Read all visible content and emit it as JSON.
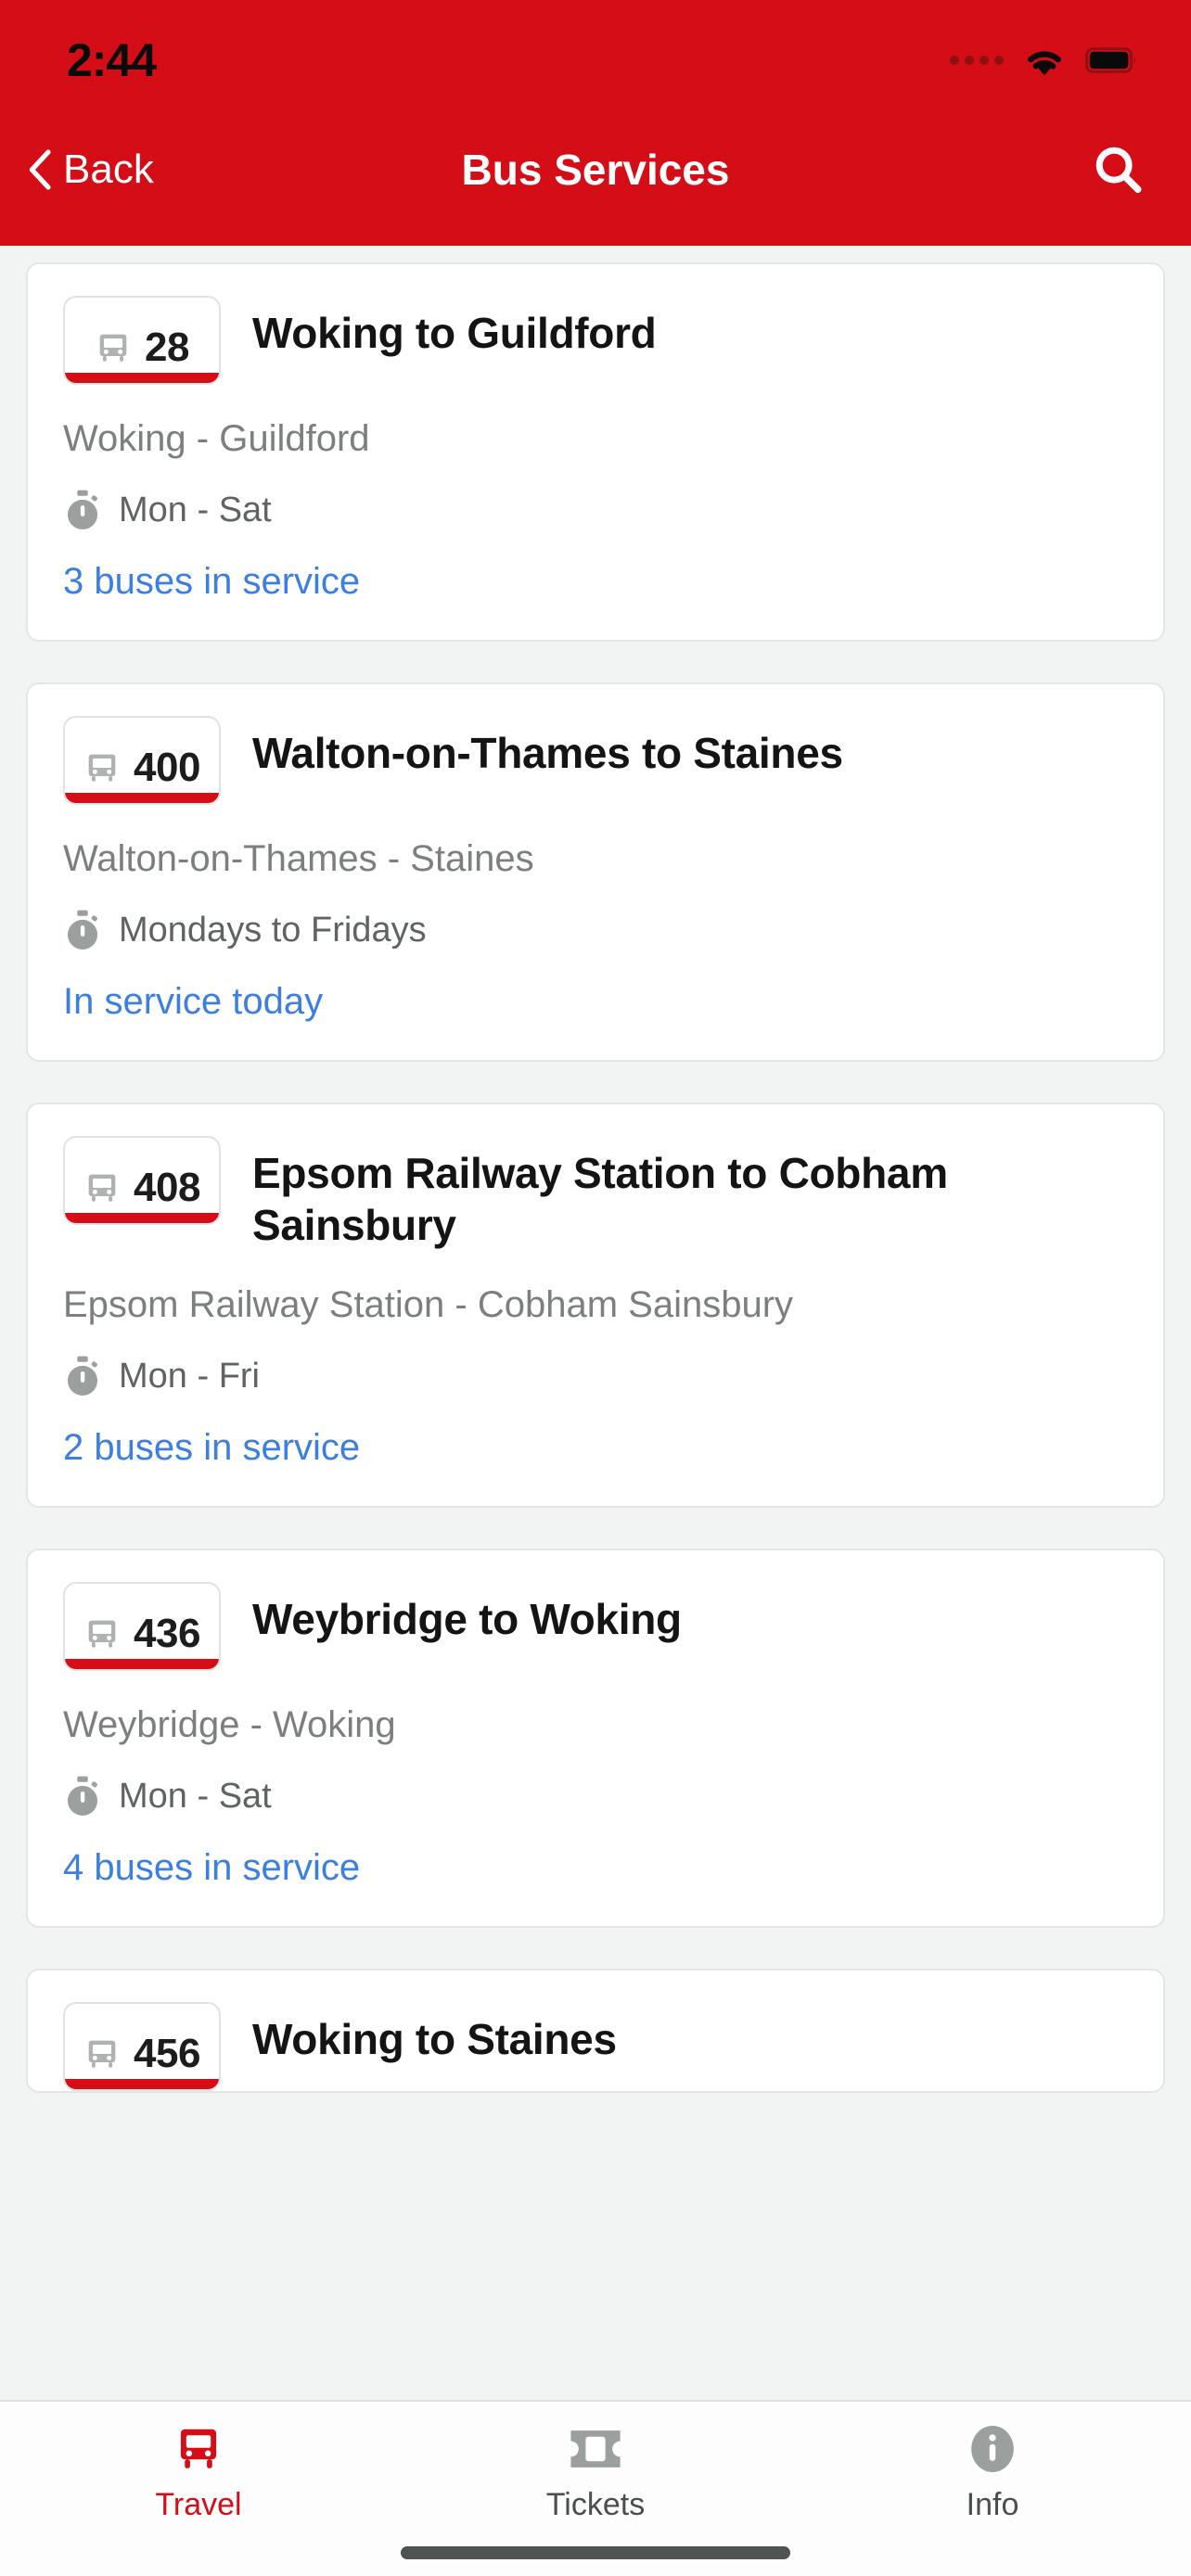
{
  "status_bar": {
    "time": "2:44",
    "signal_icon": "signal-dots-icon",
    "wifi_icon": "wifi-icon",
    "battery_icon": "battery-full-icon"
  },
  "nav": {
    "back_label": "Back",
    "back_icon": "chevron-left-icon",
    "title": "Bus Services",
    "search_icon": "search-icon"
  },
  "colors": {
    "brand_red": "#d40d17",
    "link_blue": "#3d7fe0",
    "page_bg": "#f1f4f3",
    "card_bg": "#ffffff",
    "muted_text": "#7b7f7e"
  },
  "services": [
    {
      "number": "28",
      "bus_icon": "bus-icon",
      "title": "Woking to Guildford",
      "route": "Woking - Guildford",
      "days_icon": "stopwatch-icon",
      "days": "Mon - Sat",
      "status": "3 buses in service"
    },
    {
      "number": "400",
      "bus_icon": "bus-icon",
      "title": "Walton-on-Thames to Staines",
      "route": "Walton-on-Thames - Staines",
      "days_icon": "stopwatch-icon",
      "days": "Mondays to Fridays",
      "status": "In service today"
    },
    {
      "number": "408",
      "bus_icon": "bus-icon",
      "title": "Epsom Railway Station to Cobham Sainsbury",
      "route": "Epsom Railway Station - Cobham Sainsbury",
      "days_icon": "stopwatch-icon",
      "days": "Mon - Fri",
      "status": "2 buses in service"
    },
    {
      "number": "436",
      "bus_icon": "bus-icon",
      "title": "Weybridge to Woking",
      "route": "Weybridge - Woking",
      "days_icon": "stopwatch-icon",
      "days": "Mon - Sat",
      "status": "4 buses in service"
    },
    {
      "number": "456",
      "bus_icon": "bus-icon",
      "title": "Woking to Staines",
      "route": "",
      "days_icon": "stopwatch-icon",
      "days": "",
      "status": ""
    }
  ],
  "tab_bar": {
    "items": [
      {
        "label": "Travel",
        "icon": "bus-icon",
        "active": true
      },
      {
        "label": "Tickets",
        "icon": "ticket-icon",
        "active": false
      },
      {
        "label": "Info",
        "icon": "info-circle-icon",
        "active": false
      }
    ]
  }
}
